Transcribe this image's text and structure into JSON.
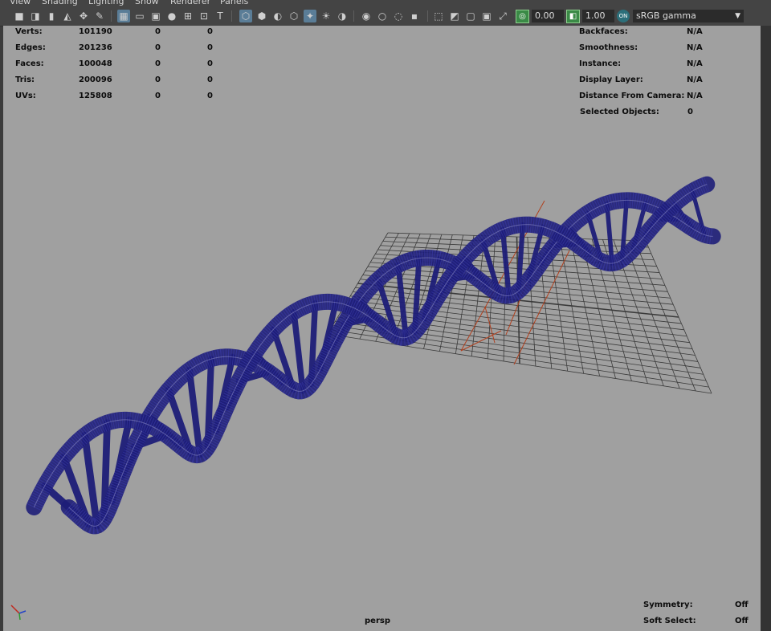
{
  "menu": [
    "View",
    "Shading",
    "Lighting",
    "Show",
    "Renderer",
    "Panels"
  ],
  "toolbar": {
    "exposure_value": "0.00",
    "gamma_value": "1.00",
    "color_space": "sRGB gamma",
    "cm_badge": "ON"
  },
  "hud_left": [
    {
      "label": "Verts:",
      "values": [
        "101190",
        "0",
        "0"
      ]
    },
    {
      "label": "Edges:",
      "values": [
        "201236",
        "0",
        "0"
      ]
    },
    {
      "label": "Faces:",
      "values": [
        "100048",
        "0",
        "0"
      ]
    },
    {
      "label": "Tris:",
      "values": [
        "200096",
        "0",
        "0"
      ]
    },
    {
      "label": "UVs:",
      "values": [
        "125808",
        "0",
        "0"
      ]
    }
  ],
  "hud_right": [
    {
      "label": "Backfaces:",
      "value": "N/A"
    },
    {
      "label": "Smoothness:",
      "value": "N/A"
    },
    {
      "label": "Instance:",
      "value": "N/A"
    },
    {
      "label": "Display Layer:",
      "value": "N/A"
    },
    {
      "label": "Distance From Camera:",
      "value": "N/A"
    },
    {
      "label": "Selected Objects:",
      "value": "0"
    }
  ],
  "camera_name": "persp",
  "bottom_right": [
    {
      "label": "Symmetry:",
      "value": "Off"
    },
    {
      "label": "Soft Select:",
      "value": "Off"
    }
  ],
  "colors": {
    "viewport_bg": "#a0a0a0",
    "wireframe": "#1e1e78",
    "grid": "#3a3a3a",
    "selection": "#b0401e",
    "toolbar_bg": "#444444",
    "active_button": "#5a7d97"
  },
  "icons": [
    "camera-icon",
    "grid-icon",
    "film-gate-icon",
    "wireframe-icon",
    "smooth-shade-icon",
    "textured-icon",
    "light-icon",
    "isolate-icon",
    "exposure-icon",
    "gamma-icon",
    "color-management-icon"
  ]
}
